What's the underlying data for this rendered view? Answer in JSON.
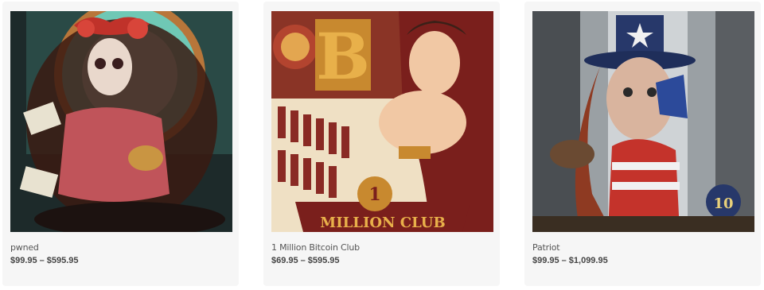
{
  "products": [
    {
      "title": "pwned",
      "price_min": "$99.95",
      "price_sep": "–",
      "price_max": "$595.95",
      "image_icon": "sugar-skull-woman-artwork"
    },
    {
      "title": "1 Million Bitcoin Club",
      "price_min": "$69.95",
      "price_sep": "–",
      "price_max": "$595.95",
      "image_icon": "bitcoin-pinup-artwork",
      "art_text": "MILLION CLUB"
    },
    {
      "title": "Patriot",
      "price_min": "$99.95",
      "price_sep": "–",
      "price_max": "$1,099.95",
      "image_icon": "uncle-sam-woman-artwork"
    }
  ],
  "colors": {
    "card_bg": "#f6f6f6",
    "title_text": "#555555",
    "price_text": "#444444"
  }
}
